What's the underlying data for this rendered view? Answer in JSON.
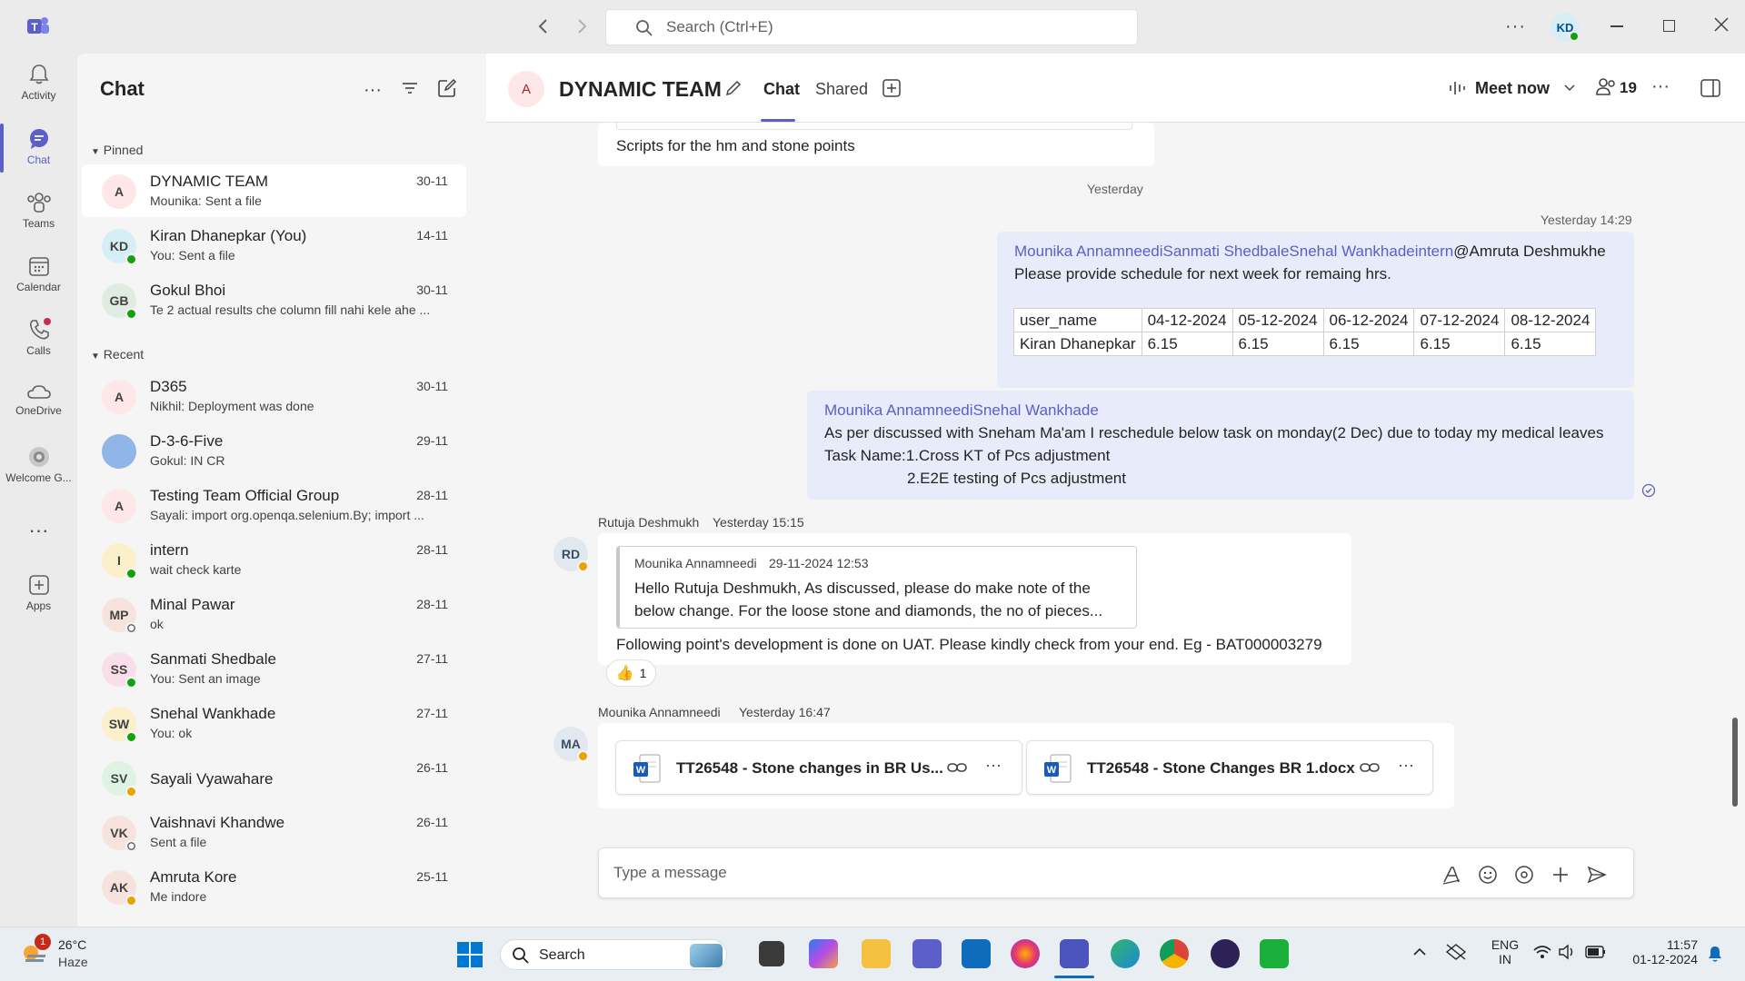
{
  "window": {
    "search_placeholder": "Search (Ctrl+E)",
    "user_initials": "KD"
  },
  "rail": [
    {
      "label": "Activity",
      "icon": "bell-icon"
    },
    {
      "label": "Chat",
      "icon": "chat-icon"
    },
    {
      "label": "Teams",
      "icon": "teams-icon"
    },
    {
      "label": "Calendar",
      "icon": "calendar-icon"
    },
    {
      "label": "Calls",
      "icon": "phone-icon"
    },
    {
      "label": "OneDrive",
      "icon": "cloud-icon"
    },
    {
      "label": "Welcome G...",
      "icon": "welcome-icon"
    },
    {
      "label": "Apps",
      "icon": "apps-icon"
    }
  ],
  "sidebar": {
    "title": "Chat",
    "pinned_label": "Pinned",
    "recent_label": "Recent",
    "pinned": [
      {
        "name": "DYNAMIC TEAM",
        "preview": "Mounika: Sent a file",
        "date": "30-11",
        "avatar": "A",
        "color": "#fde7e9"
      },
      {
        "name": "Kiran Dhanepkar (You)",
        "preview": "You: Sent a file",
        "date": "14-11",
        "avatar": "KD",
        "color": "#d7eef6",
        "presence": "available"
      },
      {
        "name": "Gokul Bhoi",
        "preview": "Te 2 actual results che column fill nahi kele ahe ...",
        "date": "30-11",
        "avatar": "GB",
        "color": "#e0ece1",
        "presence": "available"
      }
    ],
    "recent": [
      {
        "name": "D365",
        "preview": "Nikhil: Deployment was done",
        "date": "30-11",
        "avatar": "A",
        "color": "#fde7e9"
      },
      {
        "name": "D-3-6-Five",
        "preview": "Gokul: IN CR",
        "date": "29-11",
        "avatar": "",
        "color": "#8fb6e6"
      },
      {
        "name": "Testing Team Official Group",
        "preview": "Sayali: import org.openqa.selenium.By; import ...",
        "date": "28-11",
        "avatar": "A",
        "color": "#fde7e9"
      },
      {
        "name": "intern",
        "preview": "wait check karte",
        "date": "28-11",
        "avatar": "I",
        "color": "#fbf0c9",
        "presence": "available"
      },
      {
        "name": "Minal Pawar",
        "preview": "ok",
        "date": "28-11",
        "avatar": "MP",
        "color": "#f6e3dd",
        "presence": "offline"
      },
      {
        "name": "Sanmati Shedbale",
        "preview": "You: Sent an image",
        "date": "27-11",
        "avatar": "SS",
        "color": "#f9dfe9",
        "presence": "available"
      },
      {
        "name": "Snehal Wankhade",
        "preview": "You: ok",
        "date": "27-11",
        "avatar": "SW",
        "color": "#fbf0c9",
        "presence": "available"
      },
      {
        "name": "Sayali Vyawahare",
        "preview": "",
        "date": "26-11",
        "avatar": "SV",
        "color": "#dff3e4",
        "presence": "away"
      },
      {
        "name": "Vaishnavi Khandwe",
        "preview": "Sent a file",
        "date": "26-11",
        "avatar": "VK",
        "color": "#f6e3dd",
        "presence": "offline"
      },
      {
        "name": "Amruta Kore",
        "preview": "Me indore",
        "date": "25-11",
        "avatar": "AK",
        "color": "#f6e3dd",
        "presence": "away"
      }
    ]
  },
  "header": {
    "title": "DYNAMIC TEAM",
    "tab_chat": "Chat",
    "tab_shared": "Shared",
    "meet_now": "Meet now",
    "participants": "19"
  },
  "messages": {
    "prev_text": "Scripts for the hm and stone points",
    "day_divider": "Yesterday",
    "msg1_time": "Yesterday 14:29",
    "msg1_mentions": "Mounika AnnamneediSanmati ShedbaleSnehal Wankhadeintern",
    "msg1_mention2": "@Amruta Deshmukhe",
    "msg1_text": "Please provide schedule for next week for remaing hrs.",
    "table_headers": [
      "user_name",
      "04-12-2024",
      "05-12-2024",
      "06-12-2024",
      "07-12-2024",
      "08-12-2024"
    ],
    "table_row": [
      "Kiran Dhanepkar",
      "6.15",
      "6.15",
      "6.15",
      "6.15",
      "6.15"
    ],
    "msg2_mentions": "Mounika AnnamneediSnehal Wankhade",
    "msg2_line1": "As per discussed with Sneham Ma'am I reschedule below task on monday(2 Dec) due to today my medical leaves",
    "msg2_line2": "Task Name:1.Cross KT of Pcs adjustment",
    "msg2_line3": "2.E2E testing of Pcs adjustment",
    "msg3_author": "Rutuja Deshmukh",
    "msg3_time": "Yesterday 15:15",
    "msg3_avatar": "RD",
    "quote_author": "Mounika Annamneedi",
    "quote_time": "29-11-2024 12:53",
    "quote_line1": "Hello Rutuja Deshmukh, As discussed, please do make note of the",
    "quote_line2": "below change. For the loose stone and diamonds, the no of pieces...",
    "msg3_text": "Following point's development is done on UAT. Please kindly check from your end. Eg - BAT000003279",
    "reaction_count": "1",
    "msg4_author": "Mounika Annamneedi",
    "msg4_time": "Yesterday 16:47",
    "msg4_avatar": "MA",
    "file1": "TT26548 - Stone changes in BR Us...",
    "file2": "TT26548 - Stone Changes BR 1.docx"
  },
  "compose": {
    "placeholder": "Type a message"
  },
  "taskbar": {
    "weather_temp": "26°C",
    "weather_desc": "Haze",
    "weather_badge": "1",
    "search_label": "Search",
    "lang1": "ENG",
    "lang2": "IN",
    "time": "11:57",
    "date": "01-12-2024"
  },
  "colors": {
    "accent": "#5b5fc7",
    "mine_bubble": "#e8ebfa",
    "available": "#13a10e",
    "away": "#eaa300"
  }
}
